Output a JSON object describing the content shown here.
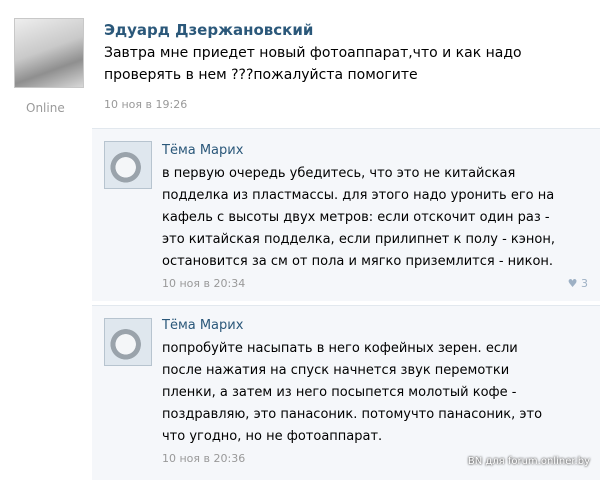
{
  "post": {
    "author": "Эдуард Дзержановский",
    "text": "Завтра мне приедет новый фотоаппарат,что и как надо\nпроверять в нем ???пожалуйста помогите",
    "time": "10 ноя в 19:26",
    "status": "Online"
  },
  "comments": [
    {
      "author": "Тёма Марих",
      "text": "в первую очередь убедитесь, что это не китайская\nподделка из пластмассы. для этого надо уронить его на\nкафель с высоты двух метров: если отскочит один раз -\nэто китайская подделка, если прилипнет к полу - кэнон,\nостановится за см от пола и мягко приземлится - никон.",
      "time": "10 ноя в 20:34",
      "likes": "3"
    },
    {
      "author": "Тёма Марих",
      "text": "попробуйте насыпать в него кофейных зерен. если\nпосле нажатия на спуск начнется звук перемотки\nпленки, а затем из него посыпется молотый кофе -\nпоздравляю, это панасоник. потомучто панасоник, это\nчто угодно, но не фотоаппарат.",
      "time": "10 ноя в 20:36"
    }
  ],
  "watermark": "BN для forum.onliner.by",
  "icons": {
    "like": "heart-icon"
  }
}
